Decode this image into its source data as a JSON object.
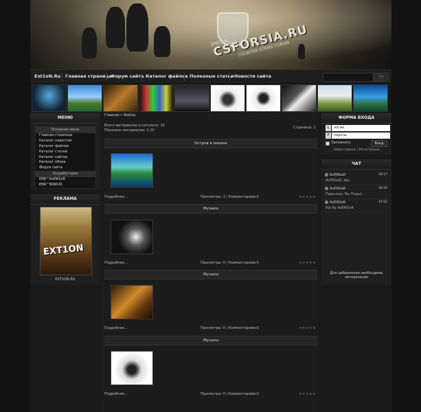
{
  "header": {
    "logo_text": "CSFORSIA.RU",
    "special_text": "SPECIAL",
    "sub_text": "COUNTER STRIKE FORUM"
  },
  "nav": {
    "items": [
      "Ext1oN.Ru",
      "Главная страница",
      "Форум сайта",
      "Каталог файлов",
      "Полезные статьи",
      "Новости сайта"
    ],
    "search_button": "OK"
  },
  "menu": {
    "title": "МЕНЮ",
    "section_main": "Основное меню",
    "items": [
      "Главная страница",
      "Каталог новостей",
      "Каталог файлов",
      "Каталог статей",
      "Каталог сайтов",
      "Каталог обоев",
      "Форум сайта"
    ],
    "section_dev": "Разработчики",
    "dev_items": [
      "ENR^AvENGeR",
      "ENR^BIRKUD"
    ]
  },
  "ads": {
    "title": "РЕКЛАМА",
    "banner_text": "EXT1ON",
    "caption": "EXT1ON.RU"
  },
  "content": {
    "breadcrumb": "Главная » Файлы",
    "total_materials": "Всего материалов в каталоге: 10",
    "shown_materials": "Показано материалов: 1-10",
    "pages": "Страницы: 1",
    "items": [
      {
        "title": "Остров в океане",
        "more": "Подробнее...",
        "stats": "Просмотры: 2 | Комментариев:0"
      },
      {
        "title": "Музыка",
        "more": "Подробнее...",
        "stats": "Просмотры: 0 | Комментариев:0"
      },
      {
        "title": "Музыка",
        "more": "Подробнее...",
        "stats": "Просмотры: 0 | Комментариев:0"
      },
      {
        "title": "Музыка",
        "more": "Подробнее...",
        "stats": "Просмотры: 0 | Комментариев:0"
      }
    ],
    "stars": "★★★★★"
  },
  "login": {
    "title": "ФОРМА ВХОДА",
    "login_icon": "L",
    "login_placeholder": "логин",
    "password_icon": "P",
    "password_placeholder": "пароль",
    "remember_label": "Запомнить",
    "submit_button": "Вход",
    "forgot_link": "Забыл пароль",
    "separator": "|",
    "register_link": "Регистрация"
  },
  "chat": {
    "title": "ЧАТ",
    "messages": [
      {
        "name": "AvENGeR",
        "time": "18:17",
        "text": "AvENGeR, Ыы"
      },
      {
        "name": "AvENGeR",
        "time": "18:16",
        "text": "Порылась Пы Поды)"
      },
      {
        "name": "AvENGeR",
        "time": "14:52",
        "text": "Rip By AvENGeR"
      }
    ],
    "notice": "Для добавления необходима авторизация"
  }
}
